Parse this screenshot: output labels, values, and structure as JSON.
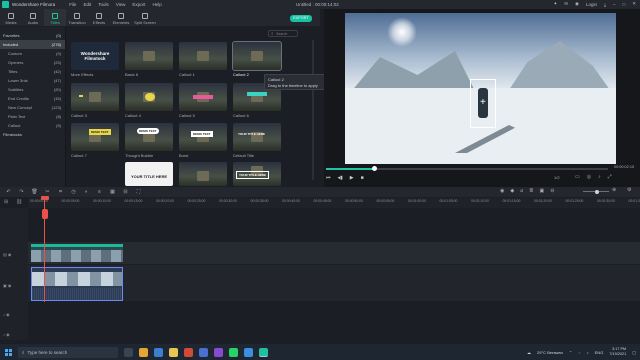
{
  "titlebar": {
    "app_name": "Wondershare Filmora",
    "menus": [
      "File",
      "Edit",
      "Tools",
      "View",
      "Export",
      "Help"
    ],
    "document": "Untitled : 00:00:14:02",
    "login": "Login"
  },
  "tabs": [
    {
      "label": "Media"
    },
    {
      "label": "Audio"
    },
    {
      "label": "Titles"
    },
    {
      "label": "Transition"
    },
    {
      "label": "Effects"
    },
    {
      "label": "Elements"
    },
    {
      "label": "Split Screen"
    }
  ],
  "export_label": "EXPORT",
  "search_placeholder": "Search",
  "sidebar": {
    "items": [
      {
        "label": "Favorites",
        "count": "(0)"
      },
      {
        "label": "Included",
        "count": "(278)"
      },
      {
        "label": "Custom",
        "count": "(0)"
      },
      {
        "label": "Openers",
        "count": "(23)"
      },
      {
        "label": "Titles",
        "count": "(42)"
      },
      {
        "label": "Lower 3rds",
        "count": "(47)"
      },
      {
        "label": "Subtitles",
        "count": "(20)"
      },
      {
        "label": "End Credits",
        "count": "(15)"
      },
      {
        "label": "New Concept",
        "count": "(123)"
      },
      {
        "label": "Plain Text",
        "count": "(8)"
      },
      {
        "label": "Callout",
        "count": "(5)"
      },
      {
        "label": "Filmstocks",
        "count": ""
      }
    ]
  },
  "grid": {
    "items": [
      {
        "label": "More Effects",
        "overlay": "Wondershare Filmstock"
      },
      {
        "label": "Basic 6",
        "overlay": ""
      },
      {
        "label": "Callout 1",
        "overlay": ""
      },
      {
        "label": "Callout 2",
        "overlay": ""
      },
      {
        "label": "Callout 3",
        "overlay": ""
      },
      {
        "label": "Callout 4",
        "overlay": ""
      },
      {
        "label": "Callout 5",
        "overlay": ""
      },
      {
        "label": "Callout 6",
        "overlay": ""
      },
      {
        "label": "Callout 7",
        "overlay": "DEMO TEXT"
      },
      {
        "label": "Thought Bubble",
        "overlay": "DEMO TEXT"
      },
      {
        "label": "Burst",
        "overlay": "DEMO TEXT"
      },
      {
        "label": "Default Title",
        "overlay": "YOUR TITLE HERE"
      },
      {
        "label": "",
        "overlay": "YOUR TITLE HERE"
      },
      {
        "label": "",
        "overlay": "YOUR TITLE HERE"
      },
      {
        "label": "",
        "overlay": ""
      },
      {
        "label": "",
        "overlay": "YOUR TITLE HERE"
      }
    ]
  },
  "tooltip": {
    "title": "Callout 2",
    "hint": "Drag to the timeline to apply"
  },
  "preview": {
    "timecode": "00:00:02:15",
    "ratio": "1/2"
  },
  "ruler": {
    "ticks": [
      "00:00:00:00",
      "00:00:05:00",
      "00:00:10:00",
      "00:00:15:00",
      "00:00:20:00",
      "00:00:25:00",
      "00:00:30:00",
      "00:00:35:00",
      "00:00:40:00",
      "00:00:45:00",
      "00:00:50:00",
      "00:00:55:00",
      "00:01:00:00",
      "00:01:05:00",
      "00:01:10:00",
      "00:01:15:00",
      "00:01:20:00",
      "00:01:25:00",
      "00:01:30:00",
      "00:01:35:00"
    ]
  },
  "taskbar": {
    "search_placeholder": "Type here to search",
    "weather": "29°C Berawan",
    "lang": "ENG",
    "time": "3:17 PM",
    "date": "7/19/2021"
  },
  "colors": {
    "accent": "#20c5a5",
    "playhead": "#e9524a",
    "selection": "#6d8cf0"
  }
}
